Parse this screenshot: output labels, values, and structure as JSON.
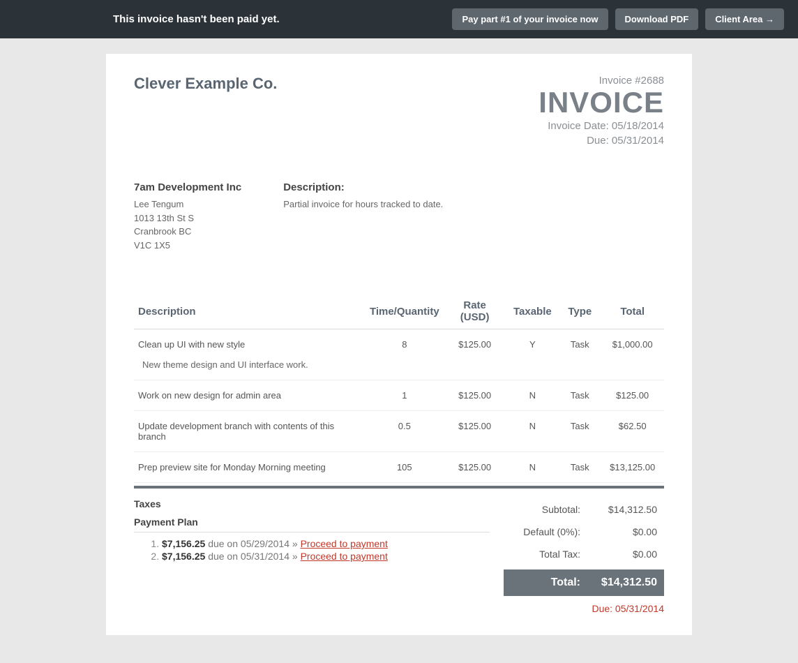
{
  "topbar": {
    "message": "This invoice hasn't been paid yet.",
    "pay_button": "Pay part #1 of your invoice now",
    "download_button": "Download PDF",
    "client_area_button": "Client Area →"
  },
  "header": {
    "company_name": "Clever Example Co.",
    "invoice_number": "Invoice #2688",
    "invoice_title": "INVOICE",
    "invoice_date": "Invoice Date: 05/18/2014",
    "due_date": "Due: 05/31/2014"
  },
  "bill_to": {
    "heading": "7am Development Inc",
    "contact": "Lee Tengum",
    "street": "1013 13th St S",
    "city": "Cranbrook BC",
    "postal": "V1C 1X5"
  },
  "description": {
    "label": "Description:",
    "text": "Partial invoice for hours tracked to date."
  },
  "columns": {
    "description": "Description",
    "qty": "Time/Quantity",
    "rate": "Rate (USD)",
    "taxable": "Taxable",
    "type": "Type",
    "total": "Total"
  },
  "items": [
    {
      "description": "Clean up UI with new style",
      "note": "New theme design and UI interface work.",
      "qty": "8",
      "rate": "$125.00",
      "taxable": "Y",
      "type": "Task",
      "total": "$1,000.00"
    },
    {
      "description": "Work on new design for admin area",
      "note": "",
      "qty": "1",
      "rate": "$125.00",
      "taxable": "N",
      "type": "Task",
      "total": "$125.00"
    },
    {
      "description": "Update development branch with contents of this branch",
      "note": "",
      "qty": "0.5",
      "rate": "$125.00",
      "taxable": "N",
      "type": "Task",
      "total": "$62.50"
    },
    {
      "description": "Prep preview site for Monday Morning meeting",
      "note": "",
      "qty": "105",
      "rate": "$125.00",
      "taxable": "N",
      "type": "Task",
      "total": "$13,125.00"
    }
  ],
  "taxes_label": "Taxes",
  "plan_label": "Payment Plan",
  "plan": [
    {
      "amount": "$7,156.25",
      "due_text": "due on",
      "date": "05/29/2014",
      "sep": "»",
      "link": "Proceed to payment"
    },
    {
      "amount": "$7,156.25",
      "due_text": "due on",
      "date": "05/31/2014",
      "sep": "»",
      "link": "Proceed to payment"
    }
  ],
  "totals": {
    "subtotal_label": "Subtotal:",
    "subtotal_value": "$14,312.50",
    "default_tax_label": "Default (0%):",
    "default_tax_value": "$0.00",
    "total_tax_label": "Total Tax:",
    "total_tax_value": "$0.00",
    "total_label": "Total:",
    "total_value": "$14,312.50",
    "due_footer": "Due: 05/31/2014"
  }
}
